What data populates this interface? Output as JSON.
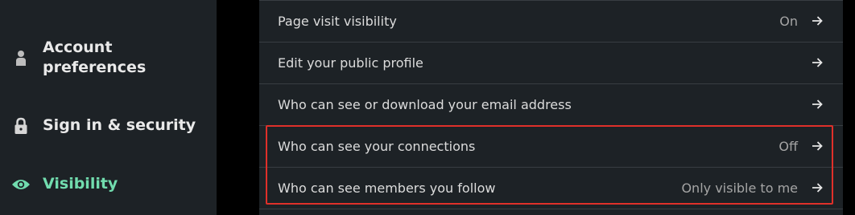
{
  "sidebar": {
    "items": [
      {
        "id": "account",
        "label": "Account preferences",
        "icon": "person-icon",
        "active": false
      },
      {
        "id": "signin",
        "label": "Sign in & security",
        "icon": "lock-icon",
        "active": false
      },
      {
        "id": "visibility",
        "label": "Visibility",
        "icon": "eye-icon",
        "active": true
      }
    ]
  },
  "settings": {
    "rows": [
      {
        "label": "Page visit visibility",
        "status": "On"
      },
      {
        "label": "Edit your public profile",
        "status": ""
      },
      {
        "label": "Who can see or download your email address",
        "status": ""
      },
      {
        "label": "Who can see your connections",
        "status": "Off"
      },
      {
        "label": "Who can see members you follow",
        "status": "Only visible to me"
      }
    ]
  },
  "colors": {
    "background": "#1d2226",
    "active_accent": "#71dcae",
    "highlight": "#e0302a",
    "divider": "#383d42"
  }
}
